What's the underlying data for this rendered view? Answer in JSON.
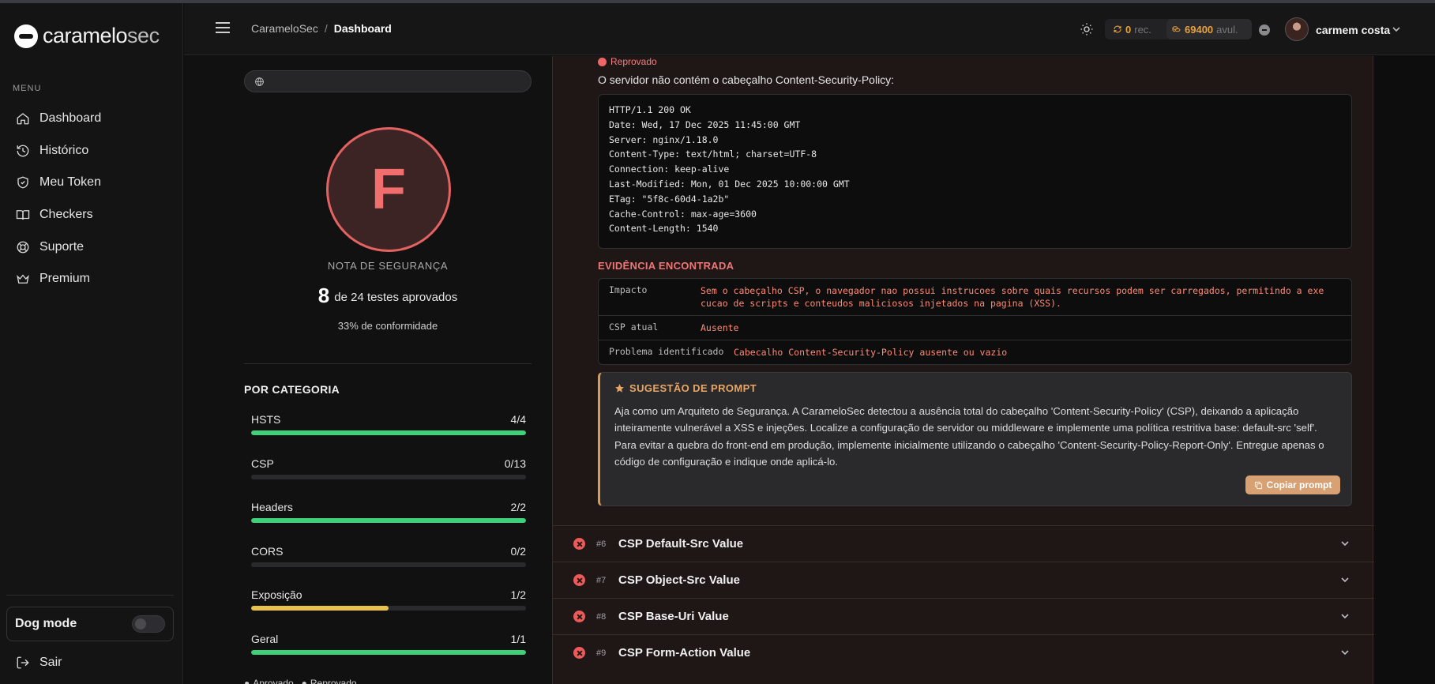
{
  "app": {
    "brand_main": "caramelo",
    "brand_sec": "sec"
  },
  "sidebar": {
    "menu_title": "MENU",
    "items": [
      {
        "label": "Dashboard",
        "icon": "home-icon"
      },
      {
        "label": "Histórico",
        "icon": "history-icon"
      },
      {
        "label": "Meu Token",
        "icon": "shield-icon"
      },
      {
        "label": "Checkers",
        "icon": "book-icon"
      },
      {
        "label": "Suporte",
        "icon": "lifebuoy-icon"
      },
      {
        "label": "Premium",
        "icon": "crown-icon"
      }
    ],
    "dog_mode_label": "Dog mode",
    "logout_label": "Sair"
  },
  "header": {
    "breadcrumb_root": "CarameloSec",
    "breadcrumb_current": "Dashboard",
    "rec_count": "0",
    "rec_unit": "rec.",
    "avul_count": "69400",
    "avul_unit": "avul.",
    "username": "carmem costa"
  },
  "score": {
    "grade": "F",
    "grade_label": "NOTA DE SEGURANÇA",
    "approved_count": "8",
    "approved_text": "de 24 testes aprovados",
    "conformity": "33% de conformidade",
    "category_title": "POR CATEGORIA",
    "categories": [
      {
        "name": "HSTS",
        "score": "4/4",
        "fraction": 1.0,
        "color": "#3fd07a"
      },
      {
        "name": "CSP",
        "score": "0/13",
        "fraction": 0.0,
        "color": "#3fd07a"
      },
      {
        "name": "Headers",
        "score": "2/2",
        "fraction": 1.0,
        "color": "#3fd07a"
      },
      {
        "name": "CORS",
        "score": "0/2",
        "fraction": 0.0,
        "color": "#3fd07a"
      },
      {
        "name": "Exposição",
        "score": "1/2",
        "fraction": 0.5,
        "color": "#e8c24a"
      },
      {
        "name": "Geral",
        "score": "1/1",
        "fraction": 1.0,
        "color": "#3fd07a"
      }
    ],
    "legend_approved": "Aprovado",
    "legend_failed": "Reprovado"
  },
  "detail": {
    "status": "Reprovado",
    "description": "O servidor não contém o cabeçalho Content-Security-Policy:",
    "code_lines": [
      "HTTP/1.1 200 OK",
      "Date: Wed, 17 Dec 2025 11:45:00 GMT",
      "Server: nginx/1.18.0",
      "Content-Type: text/html; charset=UTF-8",
      "Connection: keep-alive",
      "Last-Modified: Mon, 01 Dec 2025 10:00:00 GMT",
      "ETag: \"5f8c-60d4-1a2b\"",
      "Cache-Control: max-age=3600",
      "Content-Length: 1540"
    ],
    "evidence_title": "EVIDÊNCIA ENCONTRADA",
    "evidence": [
      {
        "key": "Impacto",
        "value": "Sem o cabeçalho CSP, o navegador nao possui instrucoes sobre quais recursos podem ser carregados, permitindo a exe cucao de scripts e conteudos maliciosos injetados na pagina (XSS)."
      },
      {
        "key": "CSP atual",
        "value": "Ausente"
      },
      {
        "key": "Problema identificado",
        "value": "Cabecalho Content-Security-Policy ausente ou vazio"
      }
    ],
    "prompt_title": "SUGESTÃO DE PROMPT",
    "prompt_text": "Aja como um Arquiteto de Segurança. A CarameloSec detectou a ausência total do cabeçalho 'Content-Security-Policy' (CSP), deixando a aplicação inteiramente vulnerável a XSS e injeções. Localize a configuração de servidor ou middleware e implemente uma política restritiva base: default-src 'self'. Para evitar a quebra do front-end em produção, implemente inicialmente utilizando o cabeçalho 'Content-Security-Policy-Report-Only'. Entregue apenas o código de configuração e indique onde aplicá-lo.",
    "copy_label": "Copiar prompt"
  },
  "tests": [
    {
      "num": "#6",
      "title": "CSP Default-Src Value"
    },
    {
      "num": "#7",
      "title": "CSP Object-Src Value"
    },
    {
      "num": "#8",
      "title": "CSP Base-Uri Value"
    },
    {
      "num": "#9",
      "title": "CSP Form-Action Value"
    }
  ]
}
